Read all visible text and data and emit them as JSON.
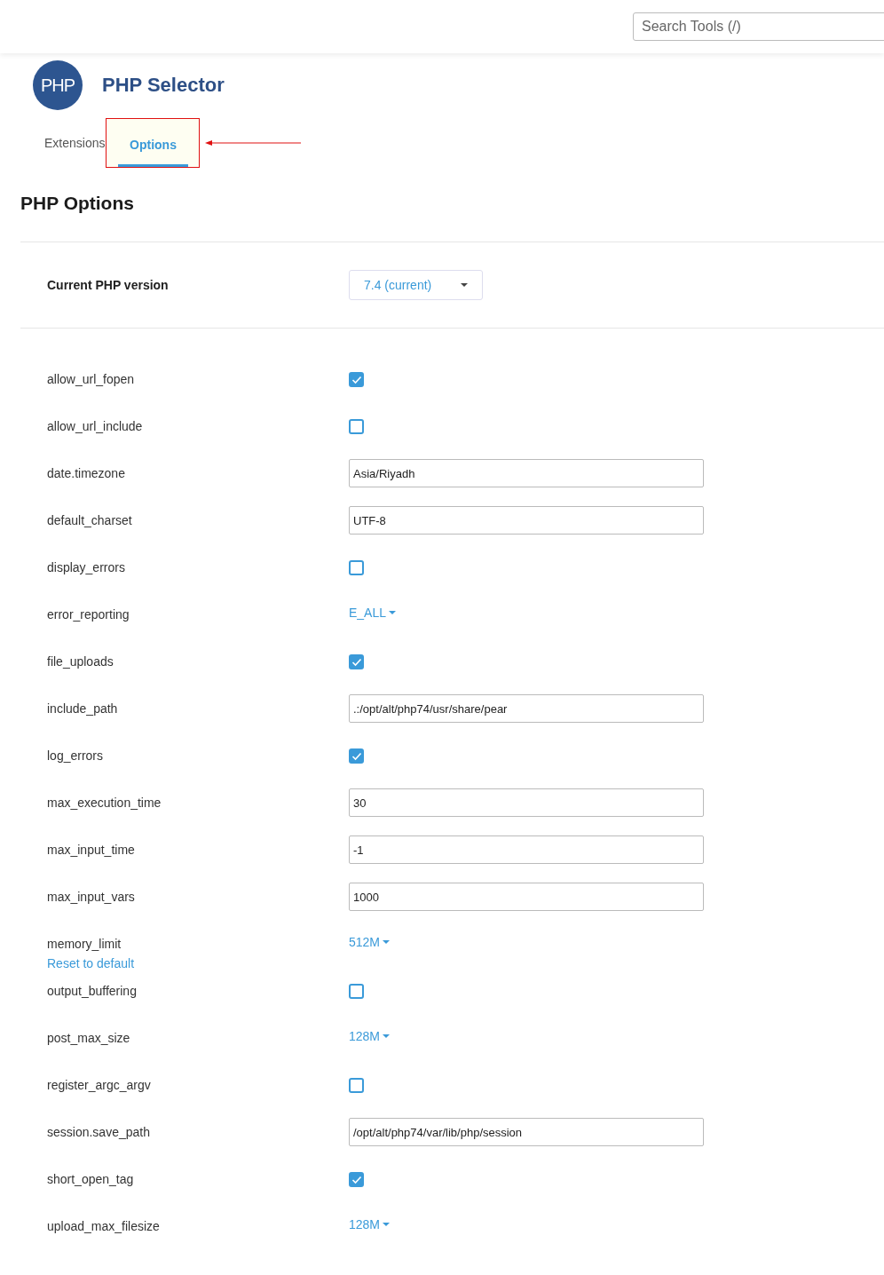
{
  "header": {
    "search": {
      "placeholder": "Search Tools (/)"
    }
  },
  "app": {
    "logo": "PHP",
    "title": "PHP Selector"
  },
  "tabs": [
    {
      "label": "Extensions",
      "selected": false
    },
    {
      "label": "Options",
      "selected": true,
      "highlighted": true
    }
  ],
  "section_title": "PHP Options",
  "version": {
    "label": "Current PHP version",
    "value": "7.4 (current)"
  },
  "options": [
    {
      "name": "allow_url_fopen",
      "kind": "checkbox",
      "checked": true
    },
    {
      "name": "allow_url_include",
      "kind": "checkbox",
      "checked": false
    },
    {
      "name": "date.timezone",
      "kind": "text",
      "value": "Asia/Riyadh"
    },
    {
      "name": "default_charset",
      "kind": "text",
      "value": "UTF-8"
    },
    {
      "name": "display_errors",
      "kind": "checkbox",
      "checked": false
    },
    {
      "name": "error_reporting",
      "kind": "dropdown",
      "value": "E_ALL"
    },
    {
      "name": "file_uploads",
      "kind": "checkbox",
      "checked": true
    },
    {
      "name": "include_path",
      "kind": "text",
      "value": ".:/opt/alt/php74/usr/share/pear"
    },
    {
      "name": "log_errors",
      "kind": "checkbox",
      "checked": true
    },
    {
      "name": "max_execution_time",
      "kind": "text",
      "value": "30"
    },
    {
      "name": "max_input_time",
      "kind": "text",
      "value": "-1"
    },
    {
      "name": "max_input_vars",
      "kind": "text",
      "value": "1000"
    },
    {
      "name": "memory_limit",
      "kind": "dropdown",
      "value": "512M",
      "reset": "Reset to default"
    },
    {
      "name": "output_buffering",
      "kind": "checkbox",
      "checked": false
    },
    {
      "name": "post_max_size",
      "kind": "dropdown",
      "value": "128M"
    },
    {
      "name": "register_argc_argv",
      "kind": "checkbox",
      "checked": false
    },
    {
      "name": "session.save_path",
      "kind": "text",
      "value": "/opt/alt/php74/var/lib/php/session"
    },
    {
      "name": "short_open_tag",
      "kind": "checkbox",
      "checked": true
    },
    {
      "name": "upload_max_filesize",
      "kind": "dropdown",
      "value": "128M"
    }
  ]
}
